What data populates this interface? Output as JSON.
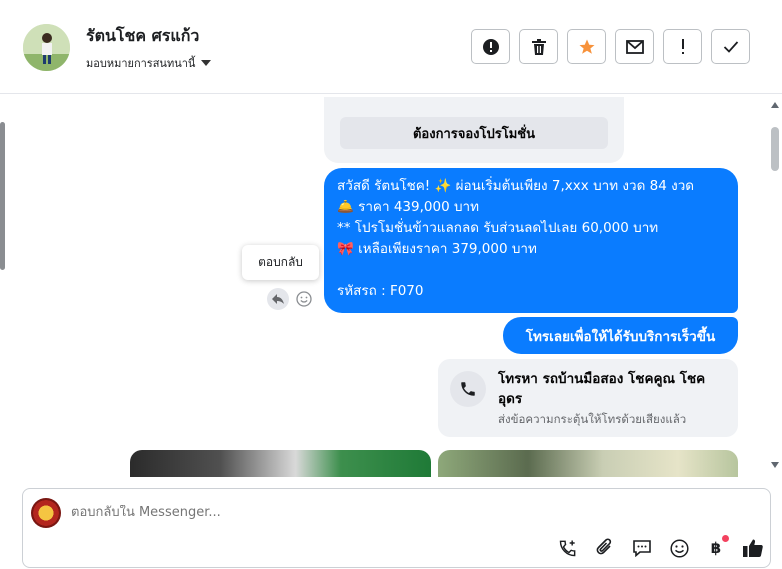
{
  "header": {
    "contact_name": "รัตนโชค ศรแก้ว",
    "assign_label": "มอบหมายการสนทนานี้",
    "actions": [
      {
        "icon": "alert-circle-icon",
        "name": "mark-spam-button"
      },
      {
        "icon": "trash-icon",
        "name": "delete-button"
      },
      {
        "icon": "star-icon",
        "name": "star-button"
      },
      {
        "icon": "envelope-icon",
        "name": "mark-unread-button"
      },
      {
        "icon": "exclamation-icon",
        "name": "follow-up-button"
      },
      {
        "icon": "check-icon",
        "name": "mark-done-button"
      }
    ],
    "star_color": "#f7923b"
  },
  "conversation": {
    "promo_button": "ต้องการจองโปรโมชั่น",
    "main_message": {
      "line1": "สวัสดี รัตนโชค! ✨  ผ่อนเริ่มต้นเพียง 7,xxx บาท งวด 84 งวด",
      "line2": "🛎️ ราคา 439,000 บาท",
      "line3": "** โปรโมชั่นข้าวแลกลด รับส่วนลดไปเลย 60,000 บาท",
      "line4": "🎀  เหลือเพียงราคา 379,000 บาท",
      "line5": "รหัสรถ : F070"
    },
    "reply_tooltip": "ตอบกลับ",
    "call_button_message": "โทรเลยเพื่อให้ได้รับบริการเร็วขึ้น",
    "call_card": {
      "title": "โทรหา รถบ้านมือสอง โชคคูณ โชคอุดร",
      "subtitle": "ส่งข้อความกระตุ้นให้โทรด้วยเสียงแล้ว"
    },
    "bubble_color": "#0a7cff"
  },
  "composer": {
    "placeholder": "ตอบกลับใน Messenger...",
    "tools": [
      "add-call-icon",
      "paperclip-icon",
      "chat-bubble-icon",
      "emoji-icon",
      "baht-icon",
      "thumbs-up-icon"
    ]
  }
}
